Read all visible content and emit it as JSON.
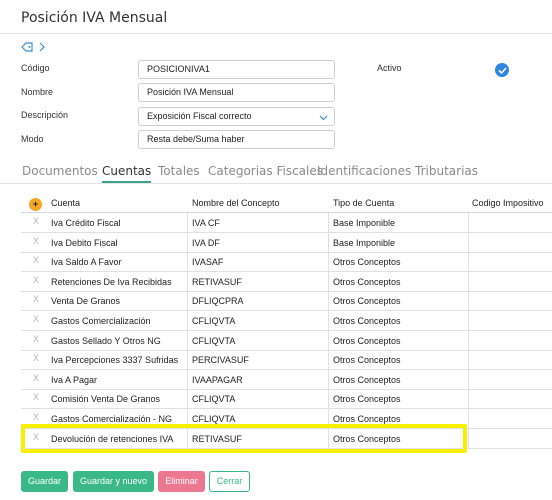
{
  "page": {
    "title": "Posición IVA Mensual"
  },
  "form": {
    "codigo_label": "Código",
    "codigo_value": "POSICIONIVA1",
    "nombre_label": "Nombre",
    "nombre_value": "Posición IVA Mensual",
    "descripcion_label": "Descripción",
    "descripcion_value": "Exposición Fiscal correcto",
    "modo_label": "Modo",
    "modo_value": "Resta debe/Suma haber",
    "activo_label": "Activo",
    "activo_checked": true
  },
  "tabs": [
    {
      "label": "Documentos",
      "active": false
    },
    {
      "label": "Cuentas",
      "active": true
    },
    {
      "label": "Totales",
      "active": false
    },
    {
      "label": "Categorias Fiscales",
      "active": false
    },
    {
      "label": "Identificaciones Tributarias",
      "active": false
    }
  ],
  "grid": {
    "add_symbol": "+",
    "remove_symbol": "X",
    "columns": [
      "Cuenta",
      "Nombre del Concepto",
      "Tipo de Cuenta",
      "Codigo Impositivo"
    ],
    "rows": [
      [
        "Iva Crédito Fiscal",
        "IVA CF",
        "Base Imponible",
        ""
      ],
      [
        "Iva Debito Fiscal",
        "IVA DF",
        "Base Imponible",
        ""
      ],
      [
        "Iva Saldo A Favor",
        "IVASAF",
        "Otros Conceptos",
        ""
      ],
      [
        "Retenciones De Iva Recibidas",
        "RETIVASUF",
        "Otros Conceptos",
        ""
      ],
      [
        "Venta De Granos",
        "DFLIQCPRA",
        "Otros Conceptos",
        ""
      ],
      [
        "Gastos Comercialización",
        "CFLIQVTA",
        "Otros Conceptos",
        ""
      ],
      [
        "Gastos Sellado Y Otros NG",
        "CFLIQVTA",
        "Otros Conceptos",
        ""
      ],
      [
        "Iva Percepciones 3337 Sufridas",
        "PERCIVASUF",
        "Otros Conceptos",
        ""
      ],
      [
        "Iva A Pagar",
        "IVAAPAGAR",
        "Otros Conceptos",
        ""
      ],
      [
        "Comisión Venta De Granos",
        "CFLIQVTA",
        "Otros Conceptos",
        ""
      ],
      [
        "Gastos Comercialización - NG",
        "CFLIQVTA",
        "Otros Conceptos",
        ""
      ],
      [
        "Devolución de retenciones IVA",
        "RETIVASUF",
        "Otros Conceptos",
        ""
      ]
    ],
    "highlight_color": "#f6f000"
  },
  "actions": {
    "guardar": "Guardar",
    "guardar_nuevo": "Guardar y nuevo",
    "eliminar": "Eliminar",
    "cerrar": "Cerrar"
  },
  "colors": {
    "accent": "#3ab887",
    "danger": "#ec7790",
    "link": "#2e86de",
    "add": "#f5a623"
  }
}
